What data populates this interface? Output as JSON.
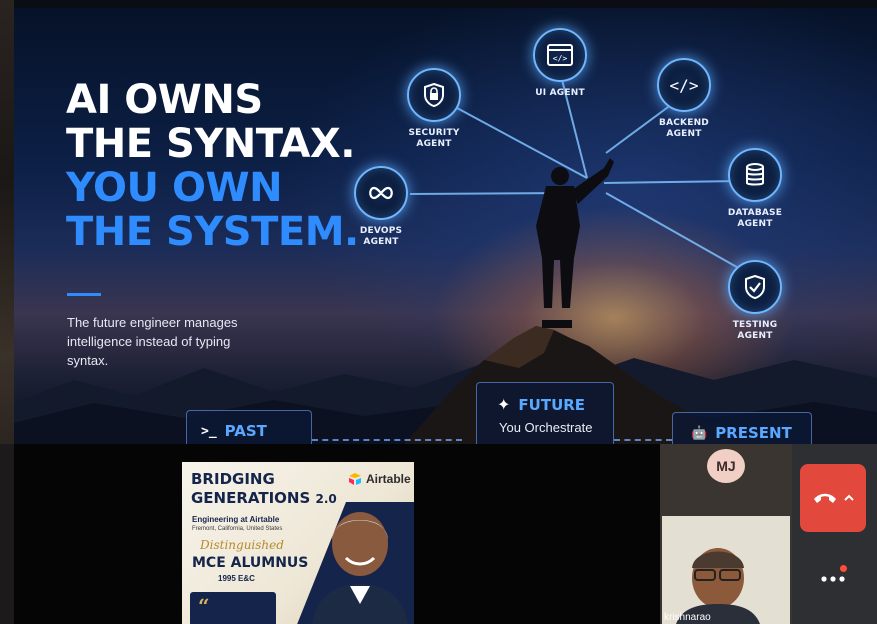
{
  "slide": {
    "headline": {
      "line1": "AI OWNS",
      "line2": "THE SYNTAX.",
      "line3": "YOU OWN",
      "line4": "THE SYSTEM."
    },
    "subtext": "The future engineer manages intelligence instead of typing syntax.",
    "agents": [
      {
        "id": "ui",
        "icon": "code-window-icon",
        "label": "UI AGENT"
      },
      {
        "id": "security",
        "icon": "lock-icon",
        "label": "SECURITY\nAGENT"
      },
      {
        "id": "backend",
        "icon": "code-brackets-icon",
        "label": "BACKEND\nAGENT"
      },
      {
        "id": "database",
        "icon": "database-icon",
        "label": "DATABASE\nAGENT"
      },
      {
        "id": "devops",
        "icon": "infinity-icon",
        "label": "DEVOPS\nAGENT"
      },
      {
        "id": "testing",
        "icon": "shield-check-icon",
        "label": "TESTING\nAGENT"
      }
    ],
    "stages": {
      "past": {
        "icon": "terminal-icon",
        "label": "PAST"
      },
      "future": {
        "icon": "sparkle-icon",
        "label": "FUTURE",
        "sub": "You Orchestrate"
      },
      "present": {
        "icon": "robot-icon",
        "label": "PRESENT"
      }
    },
    "colors": {
      "accent_blue": "#2f8cff",
      "glow": "#6fb6ff"
    }
  },
  "call": {
    "poster": {
      "title_line1": "BRIDGING",
      "title_line2": "GENERATIONS",
      "version": "2.0",
      "brand": "Airtable",
      "subtitle": "Engineering at Airtable",
      "location": "Fremont, California, United States",
      "distinguished": "Distinguished",
      "alumnus": "MCE ALUMNUS",
      "batch": "1995 E&C"
    },
    "participant": {
      "initials": "MJ",
      "name": "krishnarao"
    },
    "controls": {
      "hangup_icon": "phone-hangup-icon",
      "more_icon": "more-options-icon"
    },
    "colors": {
      "hangup": "#e2483b",
      "panel": "#2d2f33"
    }
  }
}
